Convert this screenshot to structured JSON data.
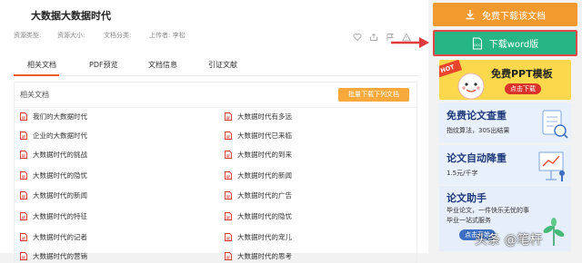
{
  "doc": {
    "title": "大数据大数据时代",
    "meta": [
      "资源类型:",
      "资源大小:",
      "文档分类:",
      "上传者: 李松"
    ]
  },
  "tabs": [
    {
      "label": "相关文档",
      "active": true
    },
    {
      "label": "PDF预览",
      "active": false
    },
    {
      "label": "文档信息",
      "active": false
    },
    {
      "label": "引证文献",
      "active": false
    }
  ],
  "related": {
    "title": "相关文档",
    "batch_button": "批量下载下列文档",
    "left": [
      "我们的大数据时代",
      "企业的大数据时代",
      "大数据时代的挑战",
      "大数据时代的隐忧",
      "大数据时代的新闻",
      "大数据时代的特征",
      "大数据时代的记者",
      "大数据时代的营销"
    ],
    "right": [
      "大数据时代有多远",
      "大数据时代已来临",
      "大数据时代的到来",
      "大数据时代的新闻",
      "大数据时代的广告",
      "大数据时代的隐忧",
      "大数据时代的宠儿",
      "大数据时代的思考"
    ]
  },
  "sidebar": {
    "download_free": "免费下载该文档",
    "download_word": "下载word版",
    "banner_ppt": {
      "hot": "HOT",
      "title": "免费PPT模板",
      "button": "点击下载"
    },
    "banner_check": {
      "title": "免费论文查重",
      "sub": "指纹算法，30S出结果"
    },
    "banner_reduce": {
      "title": "论文自动降重",
      "sub": "1.5元/千字"
    },
    "banner_assist": {
      "title": "论文助手",
      "sub1": "毕业论文，一件快乐无忧的事",
      "sub2": "毕业一站式服务",
      "button": "点击开始"
    }
  },
  "watermark": "头条 @笔杆",
  "colors": {
    "accent": "#e85d2a",
    "orange": "#f29a2e",
    "green": "#27b585",
    "pdf_red": "#d9332b"
  }
}
